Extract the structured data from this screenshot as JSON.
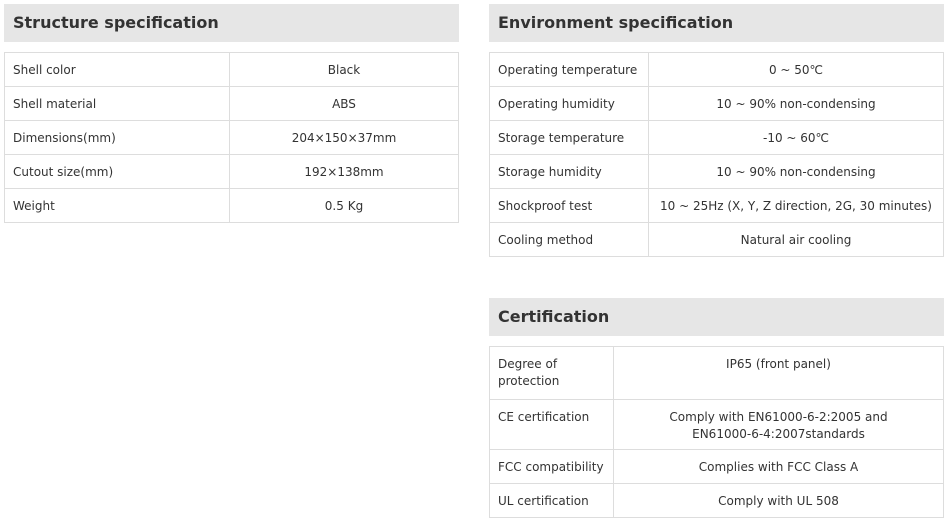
{
  "structure": {
    "title": "Structure specification",
    "rows": [
      {
        "label": "Shell color",
        "value": "Black"
      },
      {
        "label": "Shell material",
        "value": "ABS"
      },
      {
        "label": "Dimensions(mm)",
        "value": "204×150×37mm"
      },
      {
        "label": "Cutout size(mm)",
        "value": "192×138mm"
      },
      {
        "label": "Weight",
        "value": "0.5 Kg"
      }
    ]
  },
  "environment": {
    "title": "Environment specification",
    "rows": [
      {
        "label": "Operating temperature",
        "value": "0 ~ 50℃"
      },
      {
        "label": "Operating humidity",
        "value": "10 ~ 90% non-condensing"
      },
      {
        "label": "Storage temperature",
        "value": "-10 ~ 60℃"
      },
      {
        "label": "Storage humidity",
        "value": "10 ~ 90% non-condensing"
      },
      {
        "label": "Shockproof test",
        "value": "10 ~ 25Hz (X, Y, Z direction, 2G, 30 minutes)"
      },
      {
        "label": "Cooling method",
        "value": "Natural air cooling"
      }
    ]
  },
  "certification": {
    "title": "Certification",
    "rows": [
      {
        "label": "Degree of protection",
        "value": "IP65 (front panel)"
      },
      {
        "label": "CE certification",
        "value": "Comply with EN61000-6-2:2005 and EN61000-6-4:2007standards"
      },
      {
        "label": "FCC compatibility",
        "value": "Complies with FCC Class A"
      },
      {
        "label": "UL certification",
        "value": "Comply with UL 508"
      }
    ]
  }
}
